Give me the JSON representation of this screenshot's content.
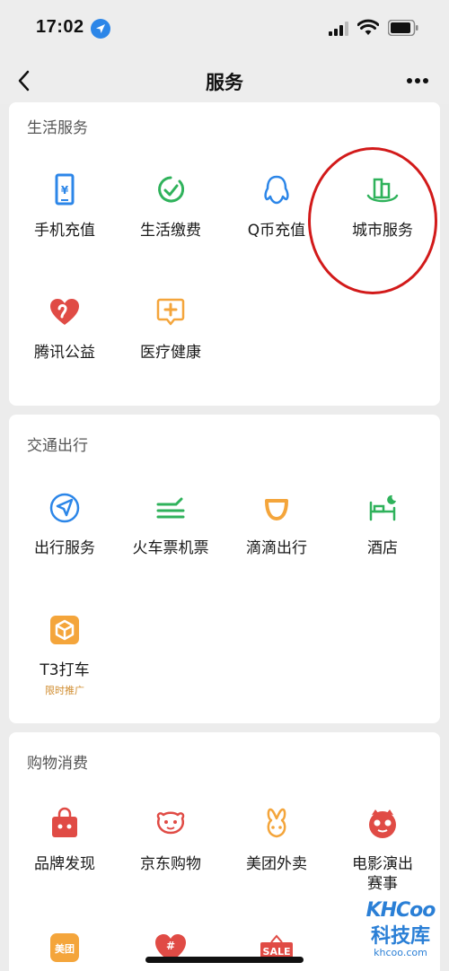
{
  "status_bar": {
    "time": "17:02"
  },
  "nav": {
    "title": "服务"
  },
  "sections": [
    {
      "title": "生活服务",
      "items": [
        {
          "label": "手机充值",
          "icon": "phone-recharge-icon"
        },
        {
          "label": "生活缴费",
          "icon": "utility-payment-icon"
        },
        {
          "label": "Q币充值",
          "icon": "qq-coin-icon"
        },
        {
          "label": "城市服务",
          "icon": "city-service-icon"
        },
        {
          "label": "腾讯公益",
          "icon": "charity-heart-icon"
        },
        {
          "label": "医疗健康",
          "icon": "medical-health-icon"
        }
      ]
    },
    {
      "title": "交通出行",
      "items": [
        {
          "label": "出行服务",
          "icon": "travel-service-icon"
        },
        {
          "label": "火车票机票",
          "icon": "train-flight-ticket-icon"
        },
        {
          "label": "滴滴出行",
          "icon": "didi-icon"
        },
        {
          "label": "酒店",
          "icon": "hotel-bed-icon"
        },
        {
          "label": "T3打车",
          "sub": "限时推广",
          "icon": "t3-taxi-icon"
        }
      ]
    },
    {
      "title": "购物消费",
      "items": [
        {
          "label": "品牌发现",
          "icon": "brand-discovery-icon"
        },
        {
          "label": "京东购物",
          "icon": "jd-shopping-icon"
        },
        {
          "label": "美团外卖",
          "icon": "meituan-waimai-icon"
        },
        {
          "label": "电影演出\n赛事",
          "label_line1": "电影演出",
          "label_line2": "赛事",
          "icon": "movie-show-icon"
        },
        {
          "label": "美团",
          "icon": "meituan-icon"
        },
        {
          "label": "#",
          "icon": "pinduoduo-icon"
        },
        {
          "label": "SALE",
          "icon": "sale-tag-icon"
        }
      ]
    }
  ],
  "watermark": {
    "logo": "KHCoo",
    "name": "科技库",
    "url": "khcoo.com"
  },
  "colors": {
    "accent_green": "#2fb25b",
    "accent_blue": "#2c86e8",
    "accent_orange": "#f4a53b",
    "accent_red": "#e04b45",
    "annotation_red": "#d21a1a"
  }
}
